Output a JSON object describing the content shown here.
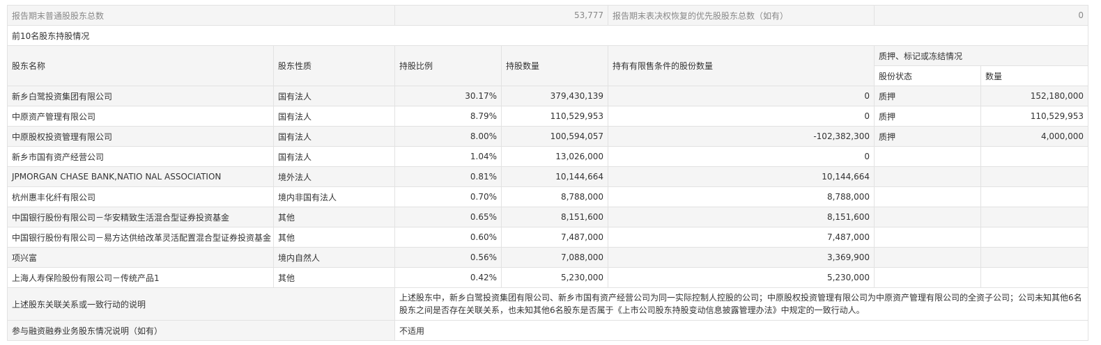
{
  "summary": {
    "common_label": "报告期末普通股股东总数",
    "common_value": "53,777",
    "preferred_label": "报告期末表决权恢复的优先股股东总数（如有）",
    "preferred_value": "0"
  },
  "section_title": "前10名股东持股情况",
  "headers": {
    "name": "股东名称",
    "nature": "股东性质",
    "ratio": "持股比例",
    "quantity": "持股数量",
    "restricted": "持有有限售条件的股份数量",
    "pledge_group": "质押、标记或冻结情况",
    "pledge_status": "股份状态",
    "pledge_qty": "数量"
  },
  "rows": [
    {
      "name": "新乡白鹭投资集团有限公司",
      "nature": "国有法人",
      "ratio": "30.17%",
      "quantity": "379,430,139",
      "restricted": "0",
      "pledge_status": "质押",
      "pledge_qty": "152,180,000"
    },
    {
      "name": "中原资产管理有限公司",
      "nature": "国有法人",
      "ratio": "8.79%",
      "quantity": "110,529,953",
      "restricted": "0",
      "pledge_status": "质押",
      "pledge_qty": "110,529,953"
    },
    {
      "name": "中原股权投资管理有限公司",
      "nature": "国有法人",
      "ratio": "8.00%",
      "quantity": "100,594,057",
      "restricted": "-102,382,300",
      "pledge_status": "质押",
      "pledge_qty": "4,000,000"
    },
    {
      "name": "新乡市国有资产经营公司",
      "nature": "国有法人",
      "ratio": "1.04%",
      "quantity": "13,026,000",
      "restricted": "0",
      "pledge_status": "",
      "pledge_qty": ""
    },
    {
      "name": "JPMORGAN CHASE BANK,NATIO NAL ASSOCIATION",
      "nature": "境外法人",
      "ratio": "0.81%",
      "quantity": "10,144,664",
      "restricted": "10,144,664",
      "pledge_status": "",
      "pledge_qty": ""
    },
    {
      "name": "杭州惠丰化纤有限公司",
      "nature": "境内非国有法人",
      "ratio": "0.70%",
      "quantity": "8,788,000",
      "restricted": "8,788,000",
      "pledge_status": "",
      "pledge_qty": ""
    },
    {
      "name": "中国银行股份有限公司－华安精致生活混合型证券投资基金",
      "nature": "其他",
      "ratio": "0.65%",
      "quantity": "8,151,600",
      "restricted": "8,151,600",
      "pledge_status": "",
      "pledge_qty": ""
    },
    {
      "name": "中国银行股份有限公司－易方达供给改革灵活配置混合型证券投资基金",
      "nature": "其他",
      "ratio": "0.60%",
      "quantity": "7,487,000",
      "restricted": "7,487,000",
      "pledge_status": "",
      "pledge_qty": ""
    },
    {
      "name": "项兴富",
      "nature": "境内自然人",
      "ratio": "0.56%",
      "quantity": "7,088,000",
      "restricted": "3,369,900",
      "pledge_status": "",
      "pledge_qty": ""
    },
    {
      "name": "上海人寿保险股份有限公司－传统产品1",
      "nature": "其他",
      "ratio": "0.42%",
      "quantity": "5,230,000",
      "restricted": "5,230,000",
      "pledge_status": "",
      "pledge_qty": ""
    }
  ],
  "relation": {
    "label": "上述股东关联关系或一致行动的说明",
    "text": "上述股东中，新乡白鹭投资集团有限公司、新乡市国有资产经营公司为同一实际控制人控股的公司；中原股权投资管理有限公司为中原资产管理有限公司的全资子公司；公司未知其他6名股东之间是否存在关联关系，也未知其他6名股东是否属于《上市公司股东持股变动信息披露管理办法》中规定的一致行动人。"
  },
  "margin_trading": {
    "label": "参与融资融券业务股东情况说明（如有）",
    "text": "不适用"
  }
}
